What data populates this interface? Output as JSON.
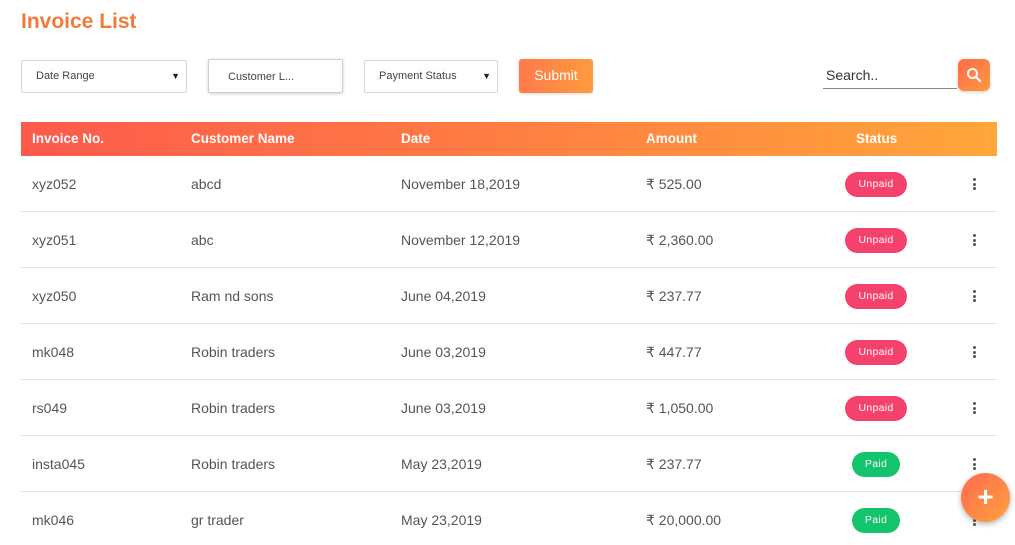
{
  "title": "Invoice List",
  "filters": {
    "date_range": "Date Range",
    "customer": "Customer L...",
    "payment_status": "Payment Status",
    "submit": "Submit",
    "search_placeholder": "Search.."
  },
  "table": {
    "headers": {
      "invoice_no": "Invoice No.",
      "customer_name": "Customer Name",
      "date": "Date",
      "amount": "Amount",
      "status": "Status"
    },
    "rows": [
      {
        "invoice_no": "xyz052",
        "customer_name": "abcd",
        "date": "November 18,2019",
        "amount": "₹ 525.00",
        "status": "Unpaid"
      },
      {
        "invoice_no": "xyz051",
        "customer_name": "abc",
        "date": "November 12,2019",
        "amount": "₹ 2,360.00",
        "status": "Unpaid"
      },
      {
        "invoice_no": "xyz050",
        "customer_name": "Ram nd sons",
        "date": "June 04,2019",
        "amount": "₹ 237.77",
        "status": "Unpaid"
      },
      {
        "invoice_no": "mk048",
        "customer_name": "Robin traders",
        "date": "June 03,2019",
        "amount": "₹ 447.77",
        "status": "Unpaid"
      },
      {
        "invoice_no": "rs049",
        "customer_name": "Robin traders",
        "date": "June 03,2019",
        "amount": "₹ 1,050.00",
        "status": "Unpaid"
      },
      {
        "invoice_no": "insta045",
        "customer_name": "Robin traders",
        "date": "May 23,2019",
        "amount": "₹ 237.77",
        "status": "Paid"
      },
      {
        "invoice_no": "mk046",
        "customer_name": "gr trader",
        "date": "May 23,2019",
        "amount": "₹ 20,000.00",
        "status": "Paid"
      }
    ]
  },
  "fab_label": "+",
  "colors": {
    "accent": "#f27a3c",
    "header_gradient_start": "#fd5a4d",
    "header_gradient_end": "#ffa63a",
    "unpaid": "#f4426c",
    "paid": "#14c46c"
  }
}
